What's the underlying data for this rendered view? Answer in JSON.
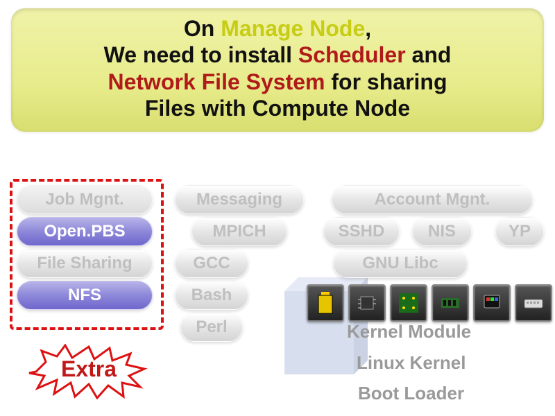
{
  "banner": {
    "line1_part1": "On ",
    "line1_part2_red": "Manage Node",
    "line1_part3": ",",
    "line2_part1": "We need to install ",
    "line2_part2_red": "Scheduler",
    "line2_part3": " and",
    "line3_part1_red": "Network File System",
    "line3_part2": " for sharing",
    "line4": "Files with Compute Node"
  },
  "left_column": {
    "job_mgnt": "Job Mgnt.",
    "openpbs": "Open.PBS",
    "file_sharing": "File Sharing",
    "nfs": "NFS"
  },
  "mid_column": {
    "messaging": "Messaging",
    "mpich": "MPICH",
    "gcc": "GCC",
    "bash": "Bash",
    "perl": "Perl"
  },
  "right_column": {
    "account_mgnt": "Account Mgnt.",
    "sshd": "SSHD",
    "nis": "NIS",
    "yp": "YP",
    "gnu_libc": "GNU Libc",
    "kernel_module": "Kernel Module",
    "linux_kernel": "Linux Kernel",
    "boot_loader": "Boot Loader"
  },
  "extra": "Extra",
  "colors": {
    "highlight_red": "#d11",
    "banner_bg": "#e8ec8c",
    "purple_pill": "#6f66cc"
  },
  "icons": [
    "battery-icon",
    "chip-icon",
    "circuit-icon",
    "ram-icon",
    "display-icon",
    "keyboard-icon"
  ]
}
